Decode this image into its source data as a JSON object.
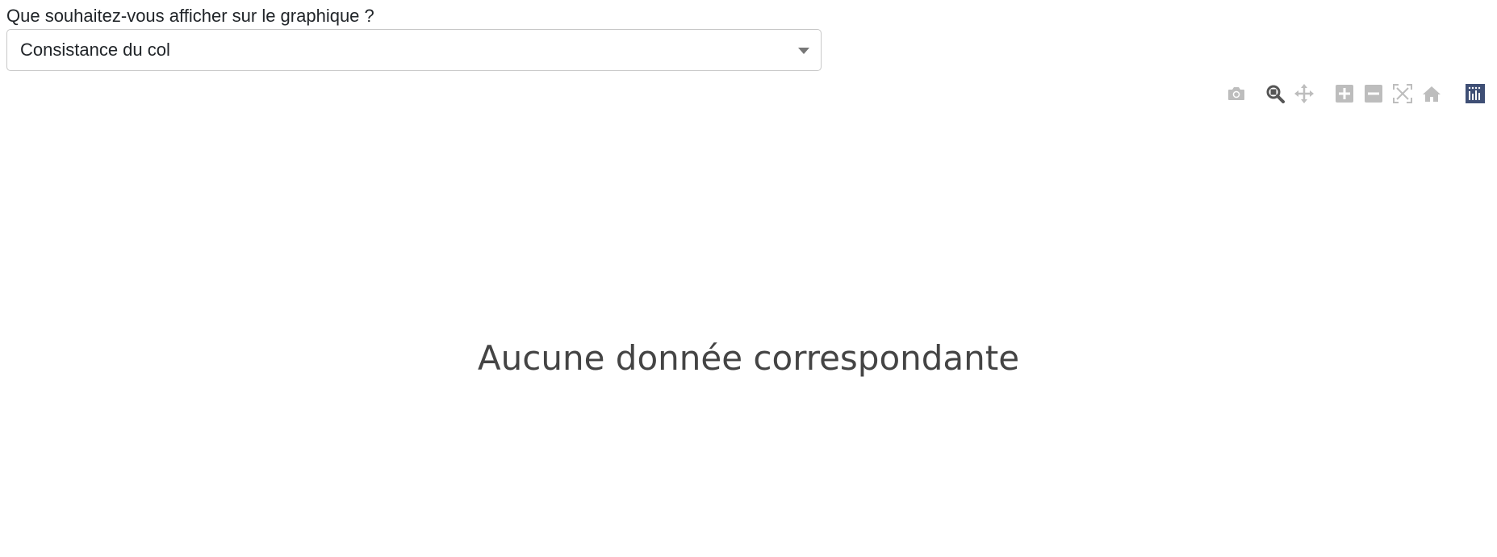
{
  "form": {
    "question_label": "Que souhaitez-vous afficher sur le graphique ?",
    "select_value": "Consistance du col"
  },
  "modebar": {
    "buttons": [
      {
        "name": "camera-icon",
        "active": false
      },
      {
        "name": "zoom-icon",
        "active": true
      },
      {
        "name": "pan-icon",
        "active": false
      },
      {
        "name": "zoom-in-icon",
        "active": false
      },
      {
        "name": "zoom-out-icon",
        "active": false
      },
      {
        "name": "autoscale-icon",
        "active": false
      },
      {
        "name": "home-icon",
        "active": false
      },
      {
        "name": "plotly-logo-icon",
        "active": false
      }
    ],
    "colors": {
      "inactive": "#bdbdbd",
      "active": "#555555",
      "logo": "#3f4f75"
    }
  },
  "plot": {
    "empty_message": "Aucune donnée correspondante"
  }
}
